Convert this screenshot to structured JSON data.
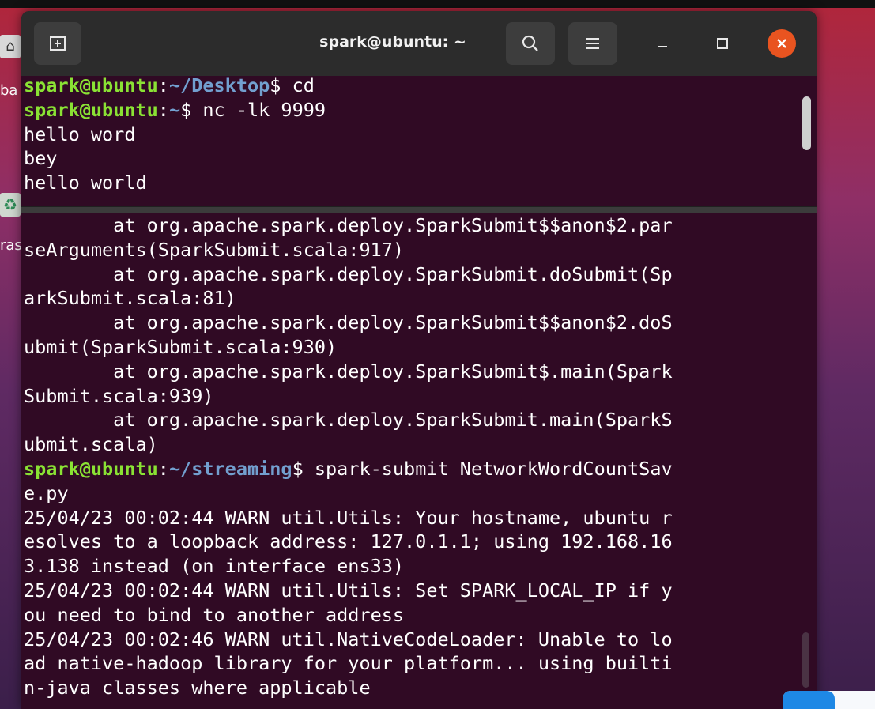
{
  "window": {
    "title": "spark@ubuntu: ~",
    "buttons": {
      "new_tab_icon": "new-tab-icon",
      "search_icon": "search-icon",
      "menu_icon": "hamburger-menu-icon",
      "minimize_icon": "minimize-icon",
      "maximize_icon": "maximize-icon",
      "close_icon": "close-icon"
    }
  },
  "colors": {
    "terminal_bg": "#300a24",
    "prompt_user": "#8ae234",
    "prompt_path": "#729fcf",
    "close_button": "#e95420",
    "titlebar": "#2c2c2c"
  },
  "desktop": {
    "label1": "ba",
    "label2": "ras"
  },
  "top_pane": {
    "lines": [
      {
        "user": "spark@ubuntu",
        "sep": ":",
        "path": "~/Desktop",
        "cmd": "$ cd"
      },
      {
        "user": "spark@ubuntu",
        "sep": ":",
        "path": "~",
        "cmd": "$ nc -lk 9999"
      },
      {
        "text": "hello word"
      },
      {
        "text": "bey"
      },
      {
        "text": "hello world"
      }
    ]
  },
  "bottom_pane": {
    "lines": [
      {
        "text": "        at org.apache.spark.deploy.SparkSubmit$$anon$2.par"
      },
      {
        "text": "seArguments(SparkSubmit.scala:917)"
      },
      {
        "text": "        at org.apache.spark.deploy.SparkSubmit.doSubmit(Sp"
      },
      {
        "text": "arkSubmit.scala:81)"
      },
      {
        "text": "        at org.apache.spark.deploy.SparkSubmit$$anon$2.doS"
      },
      {
        "text": "ubmit(SparkSubmit.scala:930)"
      },
      {
        "text": "        at org.apache.spark.deploy.SparkSubmit$.main(Spark"
      },
      {
        "text": "Submit.scala:939)"
      },
      {
        "text": "        at org.apache.spark.deploy.SparkSubmit.main(SparkS"
      },
      {
        "text": "ubmit.scala)"
      },
      {
        "user": "spark@ubuntu",
        "sep": ":",
        "path": "~/streaming",
        "cmd": "$ spark-submit NetworkWordCountSav"
      },
      {
        "text": "e.py"
      },
      {
        "text": "25/04/23 00:02:44 WARN util.Utils: Your hostname, ubuntu r"
      },
      {
        "text": "esolves to a loopback address: 127.0.1.1; using 192.168.16"
      },
      {
        "text": "3.138 instead (on interface ens33)"
      },
      {
        "text": "25/04/23 00:02:44 WARN util.Utils: Set SPARK_LOCAL_IP if y"
      },
      {
        "text": "ou need to bind to another address"
      },
      {
        "text": "25/04/23 00:02:46 WARN util.NativeCodeLoader: Unable to lo"
      },
      {
        "text": "ad native-hadoop library for your platform... using builti"
      },
      {
        "text": "n-java classes where applicable"
      }
    ]
  }
}
